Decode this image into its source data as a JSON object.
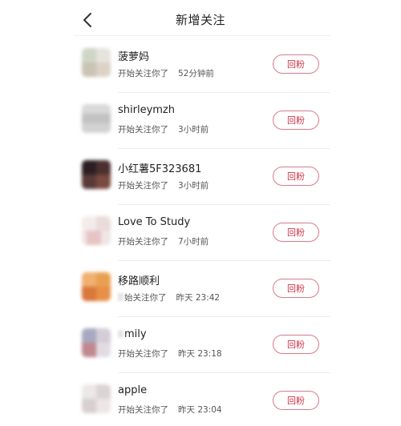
{
  "header": {
    "title": "新增关注",
    "back_icon": "chevron-left-icon"
  },
  "button_label": "回粉",
  "follow_text": "开始关注你了",
  "accent_color": "#c9364a",
  "items": [
    {
      "name": "菠萝妈",
      "action": "开始关注你了",
      "time": "52分钟前"
    },
    {
      "name": "shirleymzh",
      "action": "开始关注你了",
      "time": "3小时前"
    },
    {
      "name": "小红薯5F323681",
      "action": "开始关注你了",
      "time": "3小时前"
    },
    {
      "name": "Love To Study",
      "action": "开始关注你了",
      "time": "7小时前"
    },
    {
      "name": "移路顺利",
      "action": "始关注你了",
      "time": "昨天 23:42"
    },
    {
      "name": "mily",
      "action": "开始关注你了",
      "time": "昨天 23:18"
    },
    {
      "name": "apple",
      "action": "开始关注你了",
      "time": "昨天 23:04"
    }
  ]
}
